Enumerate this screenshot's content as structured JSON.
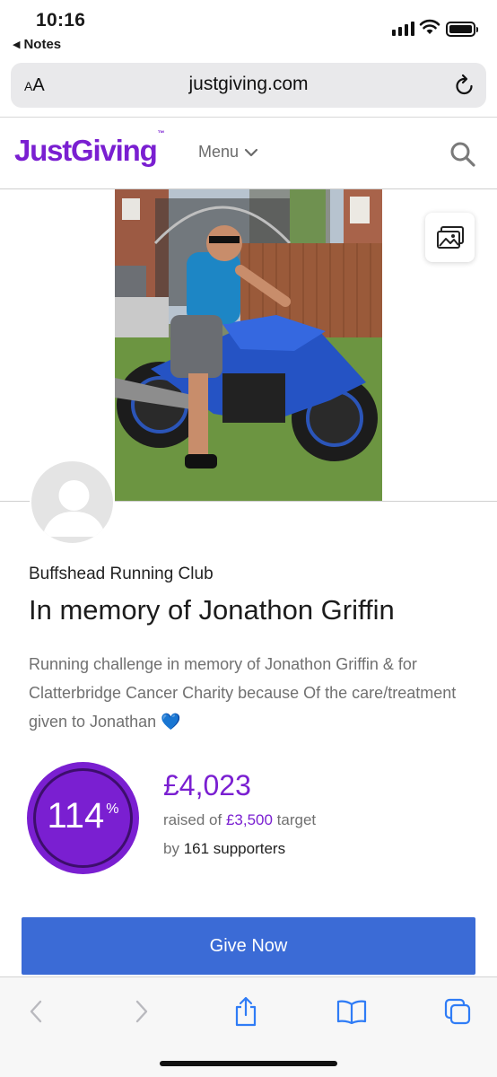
{
  "status_bar": {
    "time": "10:16",
    "back_app": "Notes"
  },
  "browser": {
    "text_size_label": "AA",
    "url": "justgiving.com"
  },
  "site_header": {
    "logo": "JustGiving",
    "logo_tm": "™",
    "menu_label": "Menu"
  },
  "page": {
    "organizer": "Buffshead Running Club",
    "title": "In memory of Jonathon Griffin",
    "description": "Running challenge in memory of Jonathon Griffin & for Clatterbridge Cancer Charity because Of the care/treatment given to Jonathan 💙",
    "progress": {
      "percent": "114",
      "percent_sign": "%",
      "percent_value": 114,
      "raised_amount": "£4,023",
      "raised_prefix": "raised of ",
      "target_amount": "£3,500",
      "target_suffix": " target",
      "supporters_prefix": "by ",
      "supporters_text": "161 supporters"
    },
    "give_button": "Give Now"
  },
  "icons": {
    "signal": "signal-icon",
    "wifi": "wifi-icon",
    "battery": "battery-icon",
    "reload": "reload-icon",
    "search": "search-icon",
    "gallery": "gallery-icon",
    "back": "back-arrow-icon",
    "forward": "forward-arrow-icon",
    "share": "share-icon",
    "bookmarks": "bookmarks-icon",
    "tabs": "tabs-icon"
  },
  "colors": {
    "brand_purple": "#7a1fd1",
    "button_blue": "#3b6bd6",
    "ios_blue": "#2f7cf6"
  }
}
